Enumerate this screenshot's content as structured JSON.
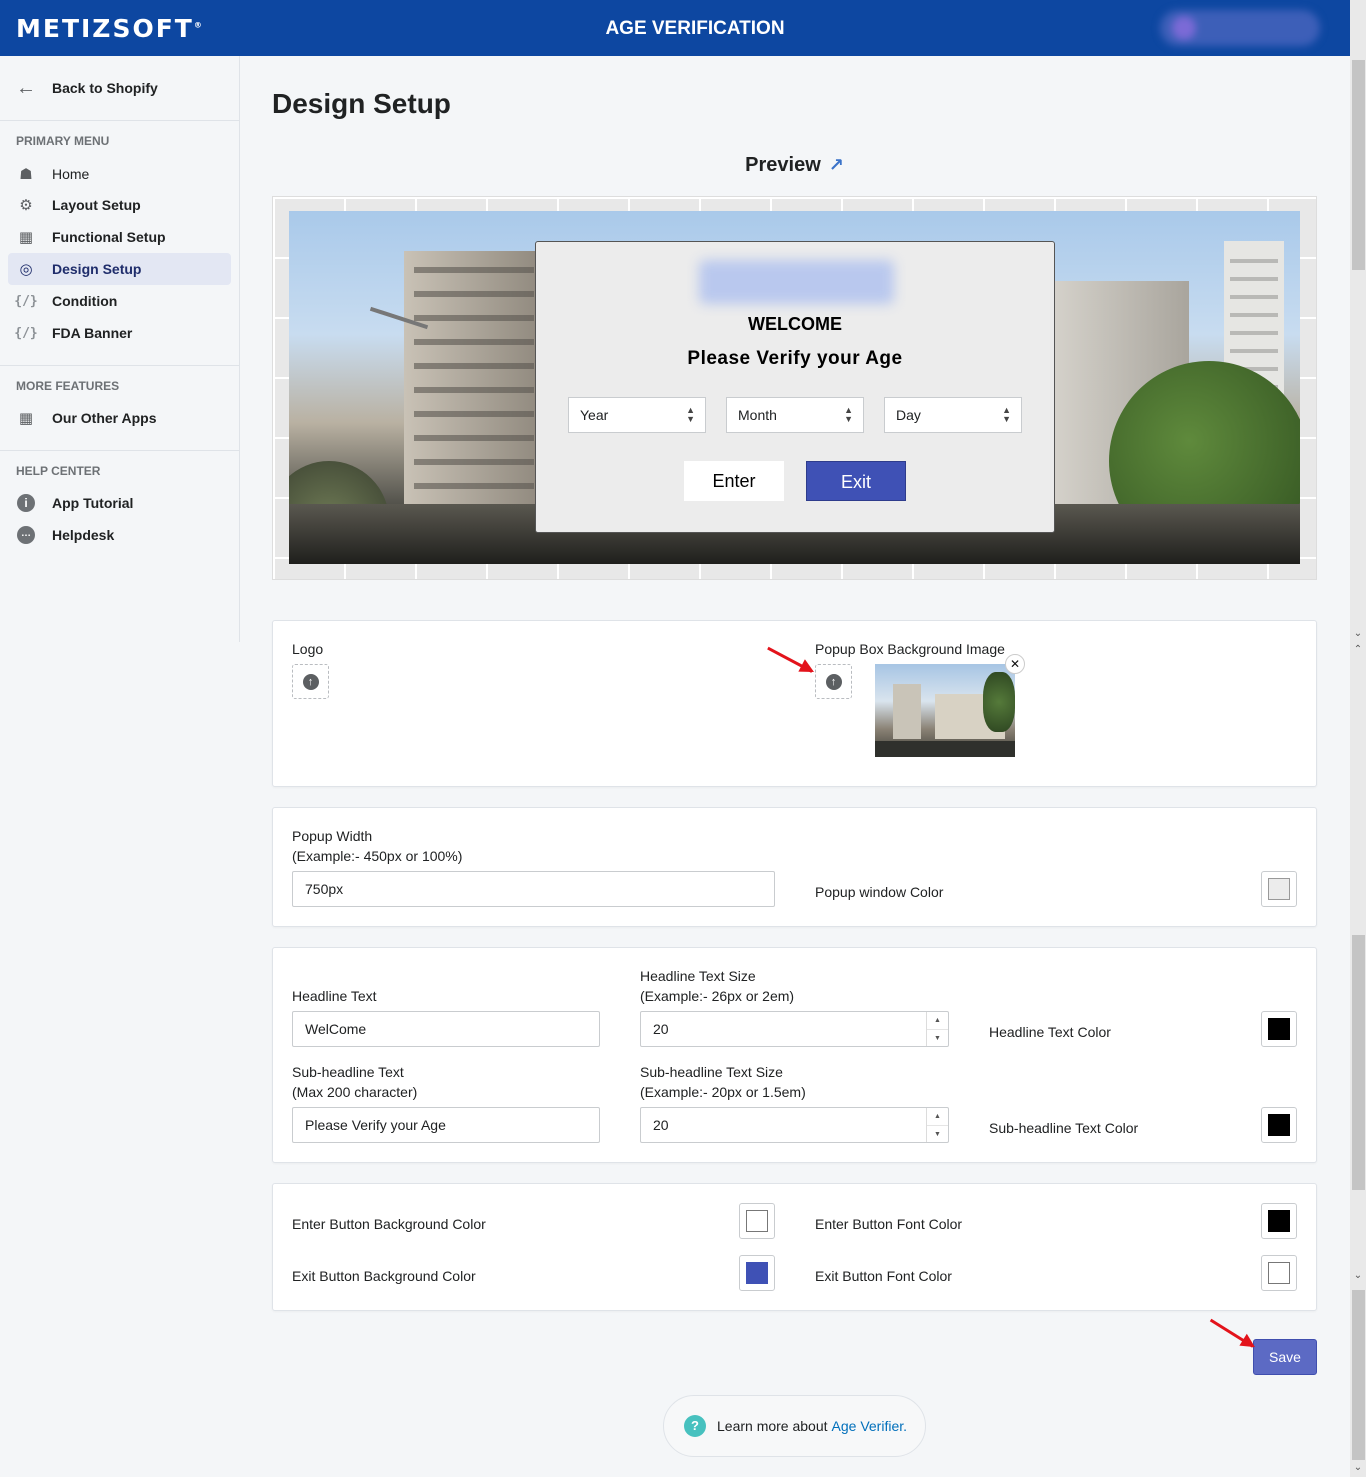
{
  "header": {
    "brand": "METIZSOFT",
    "brand_mark": "®",
    "title": "AGE VERIFICATION"
  },
  "sidebar": {
    "back_label": "Back to Shopify",
    "sections": {
      "primary": "PRIMARY MENU",
      "more": "MORE FEATURES",
      "help": "HELP CENTER"
    },
    "primary_items": [
      {
        "label": "Home",
        "icon": "home-icon"
      },
      {
        "label": "Layout Setup",
        "icon": "gear-icon"
      },
      {
        "label": "Functional Setup",
        "icon": "apps-grid-icon"
      },
      {
        "label": "Design Setup",
        "icon": "eye-icon",
        "active": true
      },
      {
        "label": "Condition",
        "icon": "code-icon"
      },
      {
        "label": "FDA Banner",
        "icon": "code-icon"
      }
    ],
    "more_items": [
      {
        "label": "Our Other Apps",
        "icon": "apps-grid-icon"
      }
    ],
    "help_items": [
      {
        "label": "App Tutorial",
        "icon": "info-icon"
      },
      {
        "label": "Helpdesk",
        "icon": "chat-icon"
      }
    ]
  },
  "main": {
    "title": "Design Setup",
    "preview_label": "Preview",
    "popup": {
      "welcome": "WELCOME",
      "subheadline": "Please Verify your Age",
      "selects": [
        "Year",
        "Month",
        "Day"
      ],
      "enter_label": "Enter",
      "exit_label": "Exit"
    },
    "logo_card": {
      "logo_label": "Logo",
      "bg_image_label": "Popup Box Background Image"
    },
    "width_card": {
      "width_label": "Popup Width",
      "width_hint": "(Example:- 450px or 100%)",
      "width_value": "750px",
      "window_color_label": "Popup window Color",
      "window_color": "#ececec"
    },
    "text_card": {
      "headline_label": "Headline Text",
      "headline_value": "WelCome",
      "headline_size_label": "Headline Text Size",
      "headline_size_hint": "(Example:- 26px or 2em)",
      "headline_size_value": "20",
      "headline_color_label": "Headline Text Color",
      "headline_color": "#000000",
      "sub_label": "Sub-headline Text",
      "sub_hint": "(Max 200 character)",
      "sub_value": "Please Verify your Age",
      "sub_size_label": "Sub-headline Text Size",
      "sub_size_hint": "(Example:- 20px or 1.5em)",
      "sub_size_value": "20",
      "sub_color_label": "Sub-headline Text Color",
      "sub_color": "#000000"
    },
    "button_card": {
      "enter_bg_label": "Enter Button Background Color",
      "enter_bg_color": "#ffffff",
      "enter_font_label": "Enter Button Font Color",
      "enter_font_color": "#000000",
      "exit_bg_label": "Exit Button Background Color",
      "exit_bg_color": "#3f51b5",
      "exit_font_label": "Exit Button Font Color",
      "exit_font_color": "#ffffff"
    },
    "save_label": "Save",
    "learn_more": {
      "text": "Learn more about",
      "link": "Age Verifier."
    }
  }
}
